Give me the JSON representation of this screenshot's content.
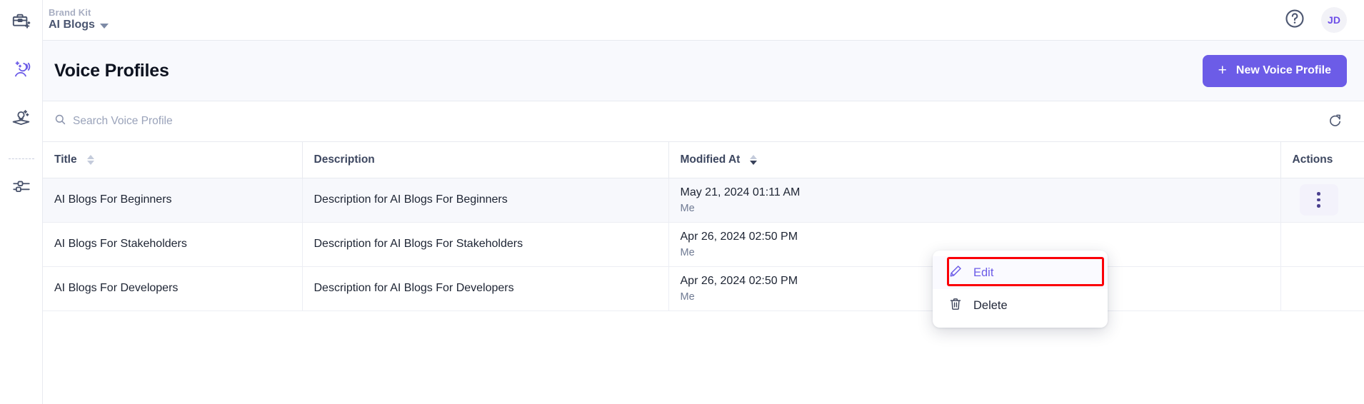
{
  "sidebar": {
    "items": [
      {
        "name": "brand-kit-icon",
        "label": "Brand Kit"
      },
      {
        "name": "voice-profiles-icon",
        "label": "Voice Profiles"
      },
      {
        "name": "knowledge-icon",
        "label": "Knowledge"
      },
      {
        "name": "settings-sliders-icon",
        "label": "Settings"
      }
    ]
  },
  "topbar": {
    "brand_kit_label": "Brand Kit",
    "brand_kit_name": "AI Blogs",
    "help_icon": "question-circle-icon",
    "avatar_initials": "JD"
  },
  "header": {
    "title": "Voice Profiles",
    "new_button_label": "New Voice Profile",
    "new_button_icon": "plus-icon",
    "accent_color": "#6c5ce7"
  },
  "search": {
    "placeholder": "Search Voice Profile",
    "value": "",
    "icon": "search-icon",
    "refresh_icon": "refresh-icon"
  },
  "table": {
    "columns": [
      {
        "key": "title",
        "label": "Title",
        "sortable": true,
        "sort": "none"
      },
      {
        "key": "description",
        "label": "Description",
        "sortable": false,
        "sort": "none"
      },
      {
        "key": "modified_at",
        "label": "Modified At",
        "sortable": true,
        "sort": "desc"
      },
      {
        "key": "actions",
        "label": "Actions",
        "sortable": false,
        "sort": "none"
      }
    ],
    "rows": [
      {
        "title": "AI Blogs For Beginners",
        "description": "Description for AI Blogs For Beginners",
        "modified_at": "May 21, 2024 01:11 AM",
        "modified_by": "Me",
        "highlighted": true
      },
      {
        "title": "AI Blogs For Stakeholders",
        "description": "Description for AI Blogs For Stakeholders",
        "modified_at": "Apr 26, 2024 02:50 PM",
        "modified_by": "Me",
        "highlighted": false
      },
      {
        "title": "AI Blogs For Developers",
        "description": "Description for AI Blogs For Developers",
        "modified_at": "Apr 26, 2024 02:50 PM",
        "modified_by": "Me",
        "highlighted": false
      }
    ]
  },
  "context_menu": {
    "items": [
      {
        "label": "Edit",
        "icon": "pencil-icon",
        "active": true
      },
      {
        "label": "Delete",
        "icon": "trash-icon",
        "active": false
      }
    ],
    "highlight_color": "#fb0007"
  }
}
